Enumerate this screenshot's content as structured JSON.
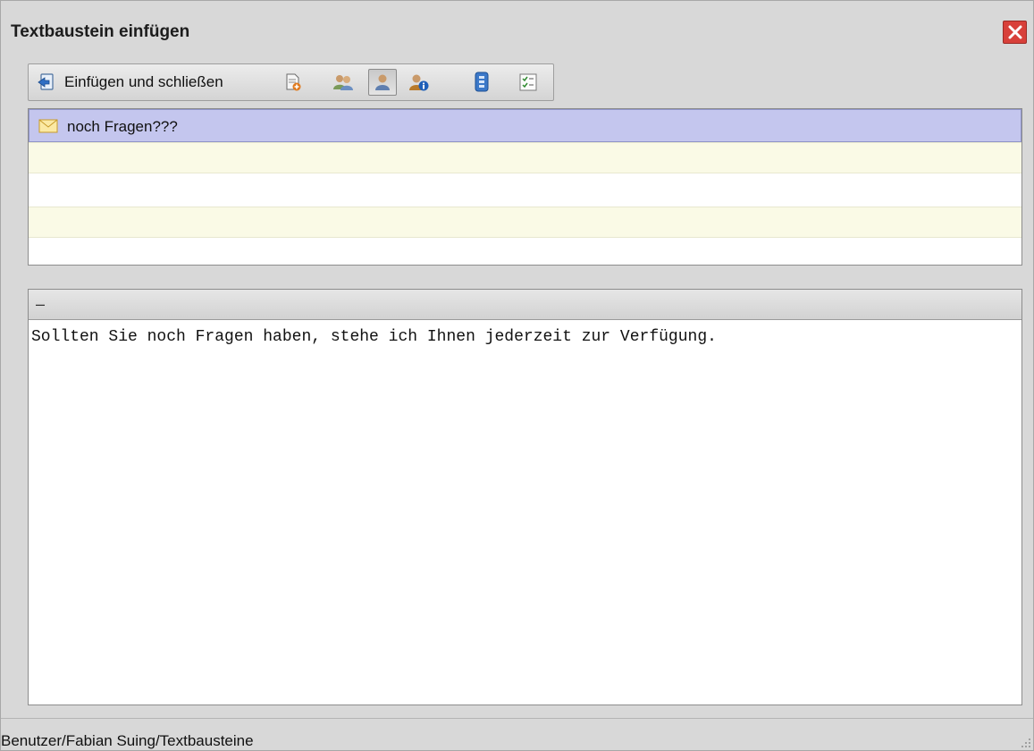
{
  "window": {
    "title": "Textbaustein einfügen",
    "close_icon": "close-icon"
  },
  "toolbar": {
    "insert_close_label": "Einfügen und schließen",
    "buttons": [
      {
        "icon": "insert-close-icon"
      },
      {
        "icon": "new-document-icon"
      },
      {
        "icon": "users-icon"
      },
      {
        "icon": "user-icon",
        "pressed": true
      },
      {
        "icon": "user-info-icon"
      },
      {
        "icon": "document-blue-icon"
      },
      {
        "icon": "checklist-icon"
      }
    ]
  },
  "list": {
    "items": [
      {
        "label": "noch Fragen???",
        "icon": "envelope-icon",
        "selected": true
      },
      {
        "label": ""
      },
      {
        "label": ""
      },
      {
        "label": ""
      },
      {
        "label": ""
      }
    ]
  },
  "preview": {
    "header": "–",
    "text": "Sollten Sie noch Fragen haben, stehe ich Ihnen jederzeit zur Verfügung."
  },
  "statusbar": {
    "path": "Benutzer/Fabian Suing/Textbausteine"
  },
  "colors": {
    "selection": "#c4c6ee",
    "alt_row": "#fafae6",
    "close": "#d8403a"
  }
}
